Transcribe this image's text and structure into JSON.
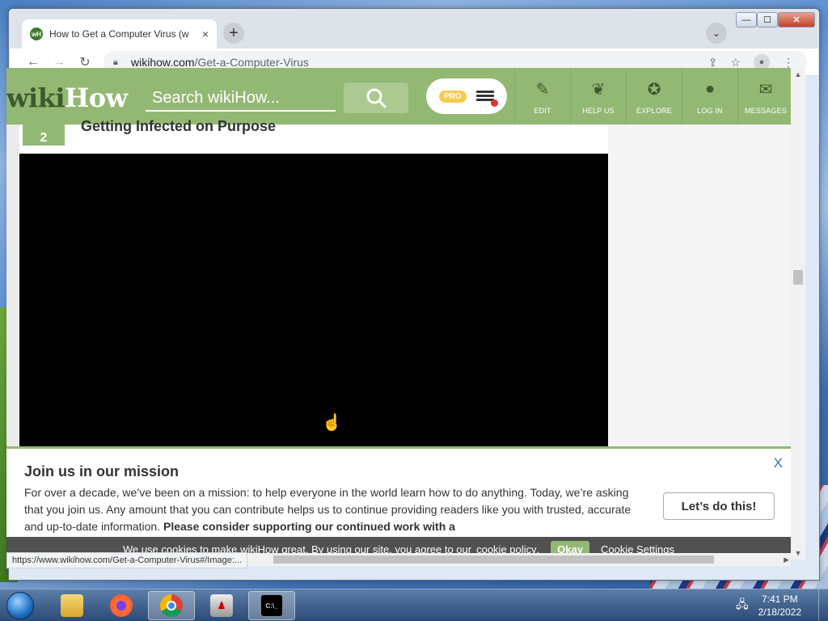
{
  "browser": {
    "tab_title": "How to Get a Computer Virus (w",
    "tab_close": "×",
    "new_tab": "+",
    "url_host": "wikihow.com",
    "url_path": "/Get-a-Computer-Virus",
    "status_url": "https://www.wikihow.com/Get-a-Computer-Virus#/Image:...",
    "window_controls": {
      "minimize": "—",
      "maximize": "☐",
      "close": "✕"
    }
  },
  "site": {
    "logo_wiki": "wiki",
    "logo_how": "How",
    "search_placeholder": "Search wikiHow...",
    "pro_badge": "PRO",
    "nav": [
      {
        "label": "EDIT",
        "icon": "pencil-icon"
      },
      {
        "label": "HELP US",
        "icon": "sprout-icon"
      },
      {
        "label": "EXPLORE",
        "icon": "compass-icon"
      },
      {
        "label": "LOG IN",
        "icon": "user-icon"
      },
      {
        "label": "MESSAGES",
        "icon": "chat-icon"
      }
    ]
  },
  "article": {
    "step_number": "2",
    "step_title": "Getting Infected on Purpose"
  },
  "mission": {
    "title": "Join us in our mission",
    "body": "For over a decade, we’ve been on a mission: to help everyone in the world learn how to do anything. Today, we’re asking that you join us. Any amount that you can contribute helps us to continue providing readers like you with trusted, accurate and up-to-date information.",
    "body_bold": "Please consider supporting our continued work with a",
    "close": "X",
    "cta": "Let’s do this!"
  },
  "cookie": {
    "text": "We use cookies to make wikiHow great. By using our site, you agree to our",
    "policy_link": "cookie policy",
    "period": ".",
    "okay": "Okay",
    "settings": "Cookie Settings"
  },
  "taskbar": {
    "time": "7:41 PM",
    "date": "2/18/2022",
    "cmd_label": "C:\\_"
  }
}
